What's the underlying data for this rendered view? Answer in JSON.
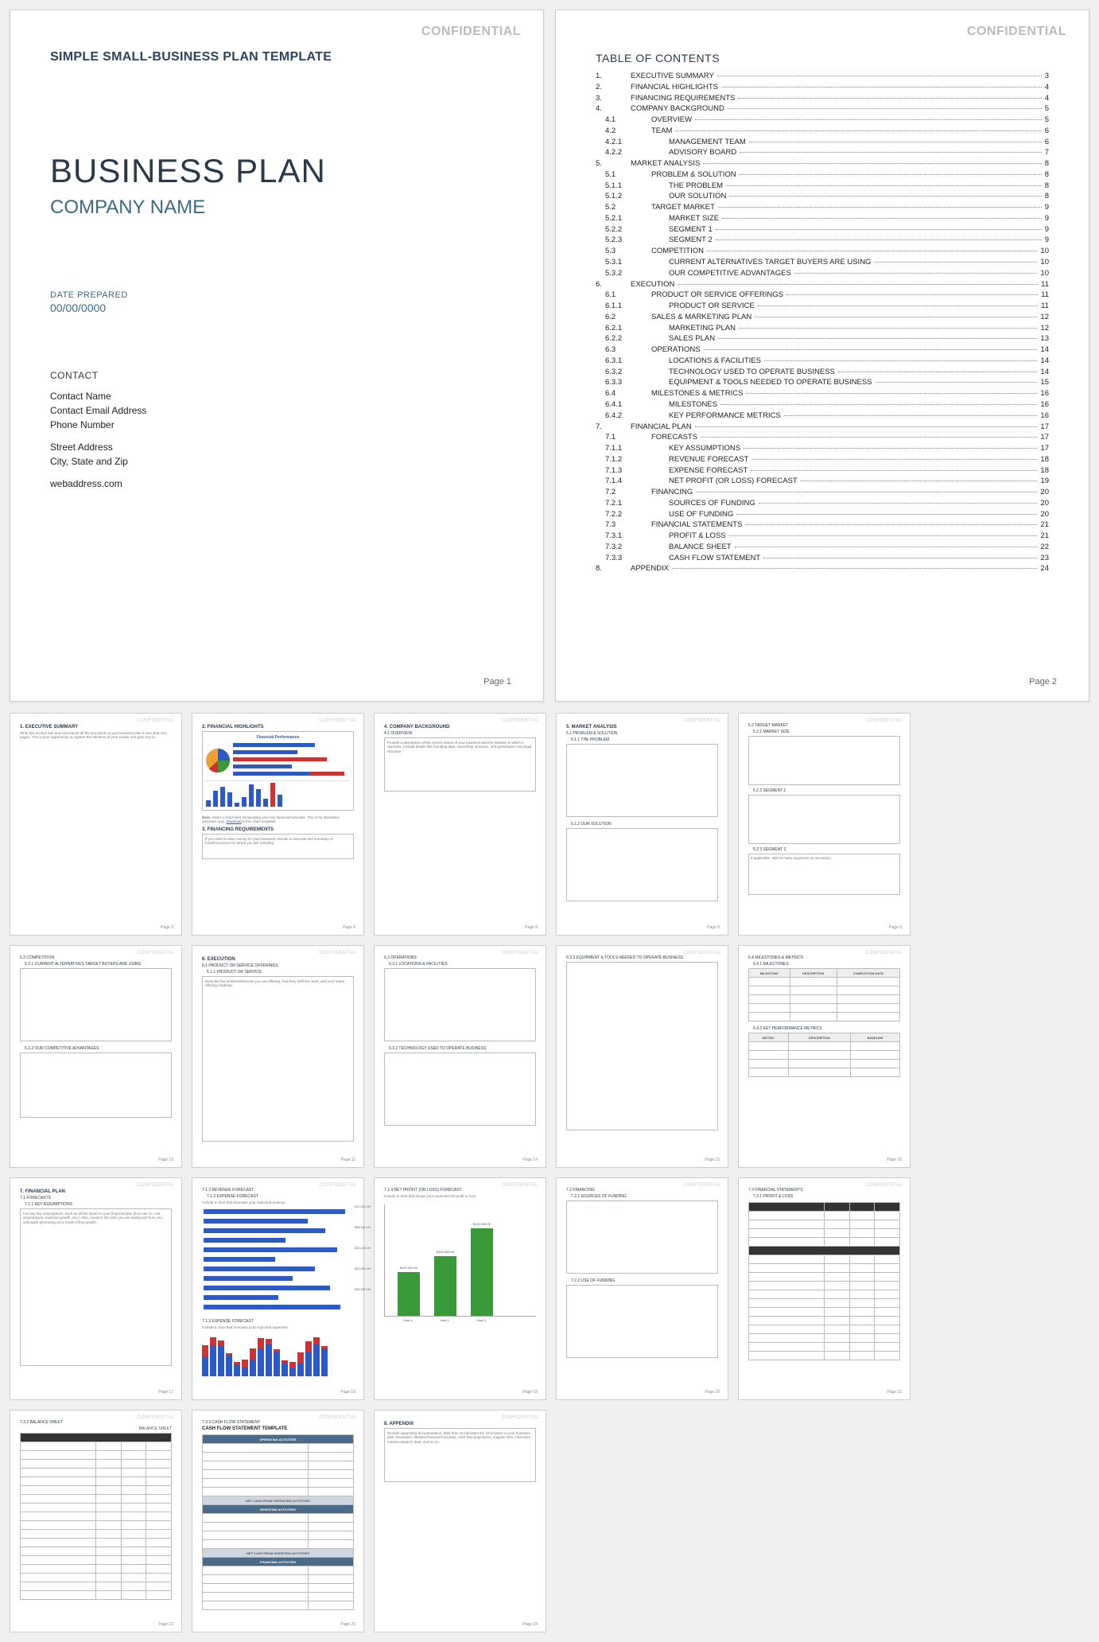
{
  "confidential": "CONFIDENTIAL",
  "cover": {
    "template_title": "SIMPLE SMALL-BUSINESS PLAN TEMPLATE",
    "plan_title": "BUSINESS PLAN",
    "company": "COMPANY NAME",
    "date_label": "DATE PREPARED",
    "date_value": "00/00/0000",
    "contact_label": "CONTACT",
    "contact_name": "Contact Name",
    "contact_email": "Contact Email Address",
    "contact_phone": "Phone Number",
    "street": "Street Address",
    "city": "City, State and Zip",
    "web": "webaddress.com",
    "page": "Page 1"
  },
  "toc": {
    "title": "TABLE OF CONTENTS",
    "page": "Page 2",
    "items": [
      {
        "n": "1.",
        "t": "EXECUTIVE SUMMARY",
        "p": "3",
        "l": 1
      },
      {
        "n": "2.",
        "t": "FINANCIAL HIGHLIGHTS",
        "p": "4",
        "l": 1
      },
      {
        "n": "3.",
        "t": "FINANCING REQUIREMENTS",
        "p": "4",
        "l": 1
      },
      {
        "n": "4.",
        "t": "COMPANY BACKGROUND",
        "p": "5",
        "l": 1
      },
      {
        "n": "4.1",
        "t": "OVERVIEW",
        "p": "5",
        "l": 2
      },
      {
        "n": "4.2",
        "t": "TEAM",
        "p": "6",
        "l": 2
      },
      {
        "n": "4.2.1",
        "t": "MANAGEMENT TEAM",
        "p": "6",
        "l": 3
      },
      {
        "n": "4.2.2",
        "t": "ADVISORY BOARD",
        "p": "7",
        "l": 3
      },
      {
        "n": "5.",
        "t": "MARKET ANALYSIS",
        "p": "8",
        "l": 1
      },
      {
        "n": "5.1",
        "t": "PROBLEM & SOLUTION",
        "p": "8",
        "l": 2
      },
      {
        "n": "5.1.1",
        "t": "THE PROBLEM",
        "p": "8",
        "l": 3
      },
      {
        "n": "5.1.2",
        "t": "OUR SOLUTION",
        "p": "8",
        "l": 3
      },
      {
        "n": "5.2",
        "t": "TARGET MARKET",
        "p": "9",
        "l": 2
      },
      {
        "n": "5.2.1",
        "t": "MARKET SIZE",
        "p": "9",
        "l": 3
      },
      {
        "n": "5.2.2",
        "t": "SEGMENT 1",
        "p": "9",
        "l": 3
      },
      {
        "n": "5.2.3",
        "t": "SEGMENT 2",
        "p": "9",
        "l": 3
      },
      {
        "n": "5.3",
        "t": "COMPETITION",
        "p": "10",
        "l": 2
      },
      {
        "n": "5.3.1",
        "t": "CURRENT ALTERNATIVES TARGET BUYERS ARE USING",
        "p": "10",
        "l": 3
      },
      {
        "n": "5.3.2",
        "t": "OUR COMPETITIVE ADVANTAGES",
        "p": "10",
        "l": 3
      },
      {
        "n": "6.",
        "t": "EXECUTION",
        "p": "11",
        "l": 1
      },
      {
        "n": "6.1",
        "t": "PRODUCT OR SERVICE OFFERINGS",
        "p": "11",
        "l": 2
      },
      {
        "n": "6.1.1",
        "t": "PRODUCT OR SERVICE",
        "p": "11",
        "l": 3
      },
      {
        "n": "6.2",
        "t": "SALES & MARKETING PLAN",
        "p": "12",
        "l": 2
      },
      {
        "n": "6.2.1",
        "t": "MARKETING PLAN",
        "p": "12",
        "l": 3
      },
      {
        "n": "6.2.2",
        "t": "SALES PLAN",
        "p": "13",
        "l": 3
      },
      {
        "n": "6.3",
        "t": "OPERATIONS",
        "p": "14",
        "l": 2
      },
      {
        "n": "6.3.1",
        "t": "LOCATIONS & FACILITIES",
        "p": "14",
        "l": 3
      },
      {
        "n": "6.3.2",
        "t": "TECHNOLOGY USED TO OPERATE BUSINESS",
        "p": "14",
        "l": 3
      },
      {
        "n": "6.3.3",
        "t": "EQUIPMENT & TOOLS NEEDED TO OPERATE BUSINESS",
        "p": "15",
        "l": 3
      },
      {
        "n": "6.4",
        "t": "MILESTONES & METRICS",
        "p": "16",
        "l": 2
      },
      {
        "n": "6.4.1",
        "t": "MILESTONES",
        "p": "16",
        "l": 3
      },
      {
        "n": "6.4.2",
        "t": "KEY PERFORMANCE METRICS",
        "p": "16",
        "l": 3
      },
      {
        "n": "7.",
        "t": "FINANCIAL PLAN",
        "p": "17",
        "l": 1
      },
      {
        "n": "7.1",
        "t": "FORECASTS",
        "p": "17",
        "l": 2
      },
      {
        "n": "7.1.1",
        "t": "KEY ASSUMPTIONS",
        "p": "17",
        "l": 3
      },
      {
        "n": "7.1.2",
        "t": "REVENUE FORECAST",
        "p": "18",
        "l": 3
      },
      {
        "n": "7.1.3",
        "t": "EXPENSE FORECAST",
        "p": "18",
        "l": 3
      },
      {
        "n": "7.1.4",
        "t": "NET PROFIT (OR LOSS) FORECAST",
        "p": "19",
        "l": 3
      },
      {
        "n": "7.2",
        "t": "FINANCING",
        "p": "20",
        "l": 2
      },
      {
        "n": "7.2.1",
        "t": "SOURCES OF FUNDING",
        "p": "20",
        "l": 3
      },
      {
        "n": "7.2.2",
        "t": "USE OF FUNDING",
        "p": "20",
        "l": 3
      },
      {
        "n": "7.3",
        "t": "FINANCIAL STATEMENTS",
        "p": "21",
        "l": 2
      },
      {
        "n": "7.3.1",
        "t": "PROFIT & LOSS",
        "p": "21",
        "l": 3
      },
      {
        "n": "7.3.2",
        "t": "BALANCE SHEET",
        "p": "22",
        "l": 3
      },
      {
        "n": "7.3.3",
        "t": "CASH FLOW STATEMENT",
        "p": "23",
        "l": 3
      },
      {
        "n": "8.",
        "t": "APPENDIX",
        "p": "24",
        "l": 1
      }
    ]
  },
  "thumbs": [
    {
      "pg": "Page 3",
      "hd": "1. EXECUTIVE SUMMARY"
    },
    {
      "pg": "Page 4",
      "hd": "2. FINANCIAL HIGHLIGHTS",
      "hd2": "3. FINANCING REQUIREMENTS",
      "chart_title": "Financial Performance"
    },
    {
      "pg": "Page 5",
      "hd": "4. COMPANY BACKGROUND",
      "sub": "4.1 OVERVIEW"
    },
    {
      "pg": "Page 8",
      "hd": "5. MARKET ANALYSIS",
      "sub": "5.1 PROBLEM & SOLUTION",
      "sub2": "5.1.1 THE PROBLEM",
      "sub3": "5.1.2 OUR SOLUTION"
    },
    {
      "pg": "Page 9",
      "sub": "5.2 TARGET MARKET",
      "sub2": "5.2.1 MARKET SIZE",
      "sub3": "5.2.2 SEGMENT 1",
      "sub4": "5.2.3 SEGMENT 2"
    },
    {
      "pg": "Page 10",
      "sub": "5.3 COMPETITION",
      "sub2": "5.3.1 CURRENT ALTERNATIVES TARGET BUYERS ARE USING",
      "sub3": "5.3.2 OUR COMPETITIVE ADVANTAGES"
    },
    {
      "pg": "Page 11",
      "hd": "6. EXECUTION",
      "sub": "6.1 PRODUCT OR SERVICE OFFERINGS",
      "sub2": "6.1.1 PRODUCT OR SERVICE"
    },
    {
      "pg": "Page 14",
      "sub": "6.3 OPERATIONS",
      "sub2": "6.3.1 LOCATIONS & FACILITIES",
      "sub3": "6.3.2 TECHNOLOGY USED TO OPERATE BUSINESS"
    },
    {
      "pg": "Page 15",
      "sub": "6.3.3 EQUIPMENT & TOOLS NEEDED TO OPERATE BUSINESS"
    },
    {
      "pg": "Page 16",
      "sub": "6.4 MILESTONES & METRICS",
      "sub2": "6.4.1 MILESTONES",
      "sub3": "6.4.2 KEY PERFORMANCE METRICS",
      "cols": [
        "MILESTONE",
        "DESCRIPTION",
        "COMPLETION DATE"
      ],
      "cols2": [
        "METRIC",
        "DESCRIPTION",
        "BASELINE"
      ]
    },
    {
      "pg": "Page 17",
      "hd": "7. FINANCIAL PLAN",
      "sub": "7.1 FORECASTS",
      "sub2": "7.1.1 KEY ASSUMPTIONS"
    },
    {
      "pg": "Page 18",
      "sub": "7.1.2 REVENUE FORECAST",
      "sub2": "7.1.3 EXPENSE FORECAST"
    },
    {
      "pg": "Page 19",
      "sub": "7.1.4 NET PROFIT (OR LOSS) FORECAST",
      "labels": [
        "Year 1",
        "Year 2",
        "Year 3"
      ],
      "values": [
        "$10,000.00",
        "$50,000.00",
        "$20,000.00",
        "$40,000.00",
        "$30,000.00",
        "$100,000.00"
      ]
    },
    {
      "pg": "Page 20",
      "sub": "7.2 FINANCING",
      "sub2": "7.2.1 SOURCES OF FUNDING",
      "sub3": "7.2.2 USE OF FUNDING"
    },
    {
      "pg": "Page 21",
      "sub": "7.3 FINANCIAL STATEMENTS",
      "sub2": "7.3.1 PROFIT & LOSS"
    },
    {
      "pg": "Page 22",
      "sub": "7.3.2 BALANCE SHEET",
      "title": "BALANCE SHEET"
    },
    {
      "pg": "Page 23",
      "sub": "7.3.3 CASH FLOW STATEMENT",
      "title": "CASH FLOW STATEMENT TEMPLATE",
      "rows": [
        "OPERATING ACTIVITIES",
        "NET CASH FROM OPERATING ACTIVITIES",
        "INVESTING ACTIVITIES",
        "NET CASH FROM INVESTING ACTIVITIES",
        "FINANCING ACTIVITIES"
      ]
    },
    {
      "pg": "Page 24",
      "hd": "8. APPENDIX"
    }
  ]
}
